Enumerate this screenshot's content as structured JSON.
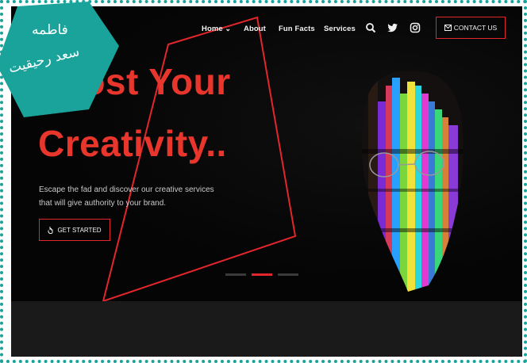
{
  "nav": {
    "items": [
      "Home",
      "About",
      "Fun Facts",
      "Services"
    ],
    "home_caret": "⌄",
    "icons": [
      "search-icon",
      "twitter-icon",
      "instagram-icon"
    ],
    "contact_label": "CONTACT US"
  },
  "hero": {
    "headline_line1": "Boost Your",
    "headline_line2": "Creativity..",
    "description_line1": "Escape the fad and discover our creative services",
    "description_line2": "that will give authority to your brand.",
    "cta_label": "GET STARTED"
  },
  "slider": {
    "count": 3,
    "active_index": 1
  },
  "badge": {
    "line1": "فاطمه",
    "line2": "سعد رحيقيت"
  },
  "colors": {
    "accent": "#e3262c",
    "headline": "#e8362d",
    "background": "#050505",
    "badge": "#1aa39a",
    "lower_band": "#1a1a1a"
  }
}
